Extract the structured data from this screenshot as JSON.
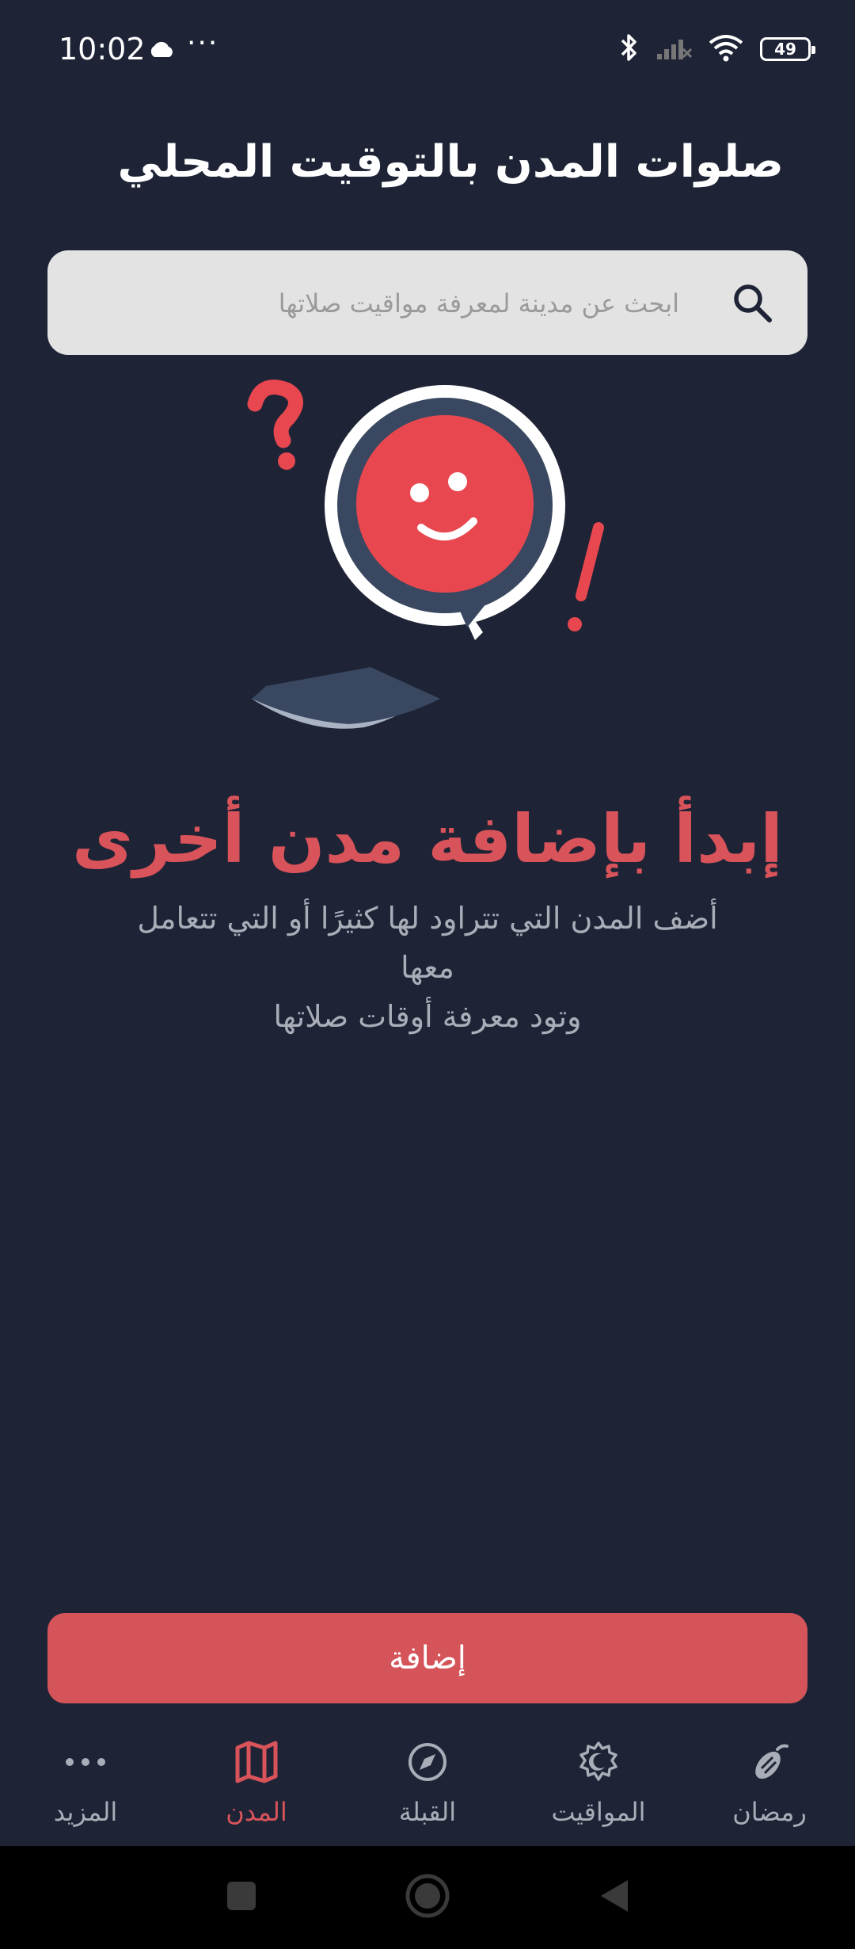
{
  "status_bar": {
    "time": "10:02",
    "more_dots": "···",
    "battery_level": "49"
  },
  "header": {
    "title": "صلوات المدن بالتوقيت المحلي"
  },
  "search": {
    "placeholder": "ابحث عن مدينة لمعرفة مواقيت صلاتها",
    "value": ""
  },
  "empty_state": {
    "heading": "إبدأ بإضافة مدن أخرى",
    "description_line1": "أضف المدن التي تتراود لها كثيرًا أو التي تتعامل معها",
    "description_line2": "وتود معرفة أوقات صلاتها"
  },
  "actions": {
    "add_label": "إضافة"
  },
  "bottom_nav": {
    "items": [
      {
        "label": "المزيد",
        "icon": "more-dots-icon"
      },
      {
        "label": "المدن",
        "icon": "map-icon",
        "active": true
      },
      {
        "label": "القبلة",
        "icon": "compass-icon"
      },
      {
        "label": "المواقيت",
        "icon": "crescent-sun-icon"
      },
      {
        "label": "رمضان",
        "icon": "dates-icon"
      }
    ]
  },
  "colors": {
    "background": "#1e2436",
    "accent": "#d4545a",
    "muted_text": "#a9adb8",
    "search_bg": "#e3e3e3"
  }
}
